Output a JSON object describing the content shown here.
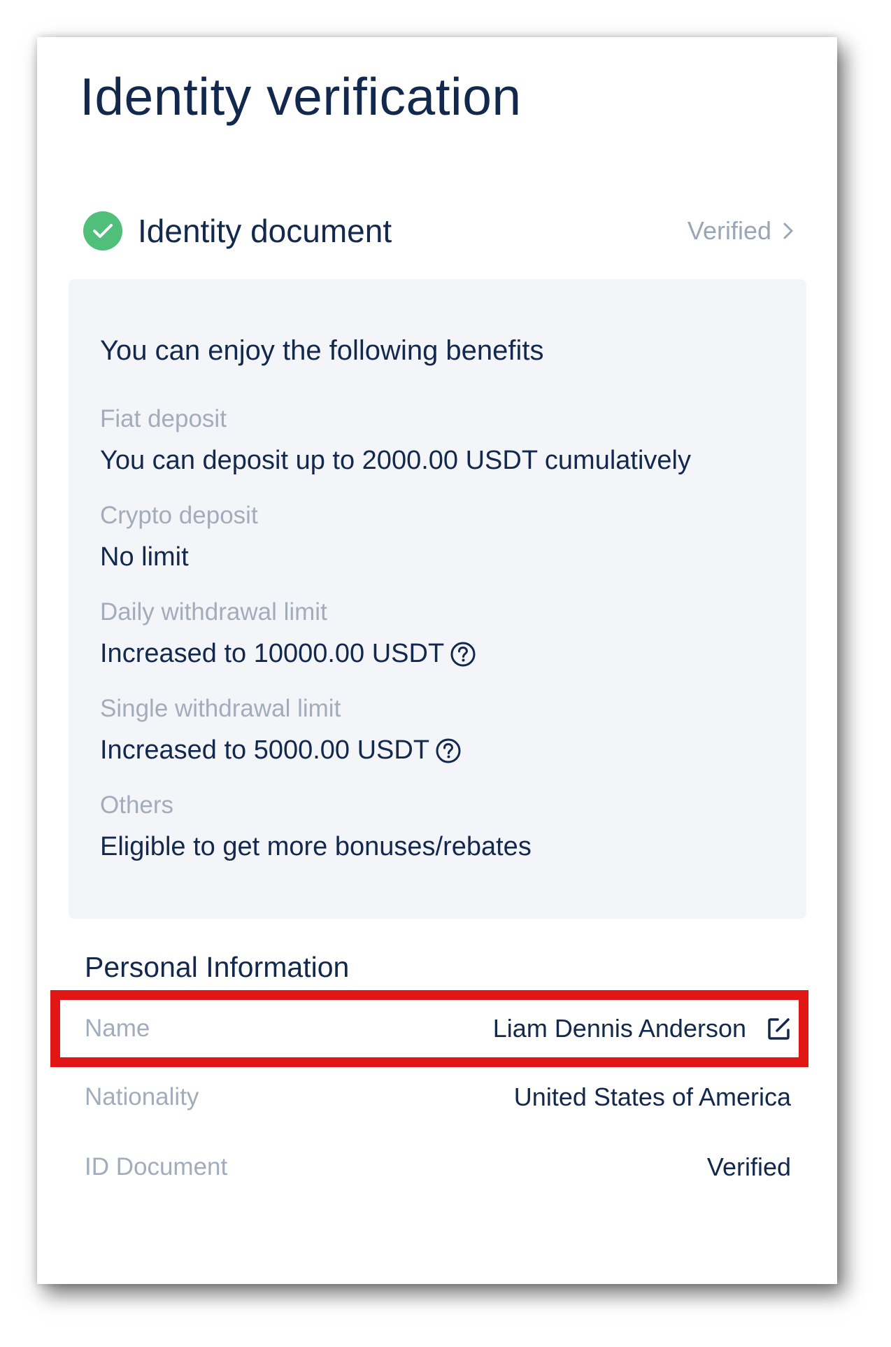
{
  "page": {
    "title": "Identity verification"
  },
  "identity_document": {
    "label": "Identity document",
    "status": "Verified",
    "status_icon": "check-circle-icon",
    "chevron_icon": "chevron-right-icon"
  },
  "benefits": {
    "heading": "You can enjoy the following benefits",
    "items": [
      {
        "label": "Fiat deposit",
        "value": "You can deposit up to 2000.00 USDT cumulatively"
      },
      {
        "label": "Crypto deposit",
        "value": "No limit"
      },
      {
        "label": "Daily withdrawal limit",
        "value": "Increased to 10000.00 USDT"
      },
      {
        "label": "Single withdrawal limit",
        "value": "Increased to 5000.00 USDT"
      },
      {
        "label": "Others",
        "value": "Eligible to get more bonuses/rebates"
      }
    ]
  },
  "personal_information": {
    "heading": "Personal Information",
    "rows": [
      {
        "label": "Name",
        "value": "Liam Dennis Anderson"
      },
      {
        "label": "Nationality",
        "value": "United States of America"
      },
      {
        "label": "ID Document",
        "value": "Verified"
      }
    ]
  },
  "colors": {
    "text_primary": "#13284d",
    "text_muted": "#a3acba",
    "success": "#4fbf7a",
    "panel_bg": "#f3f5f9",
    "highlight": "#e21614"
  }
}
